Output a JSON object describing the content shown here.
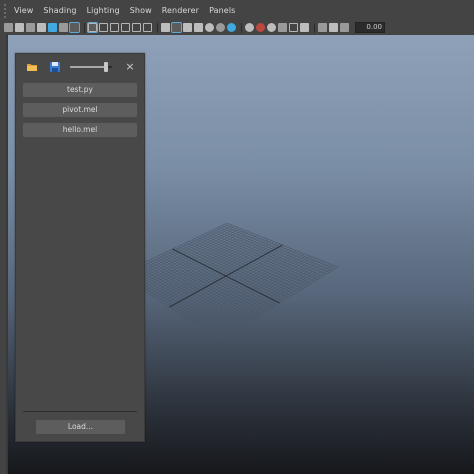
{
  "menubar": {
    "items": [
      "View",
      "Shading",
      "Lighting",
      "Show",
      "Renderer",
      "Panels"
    ]
  },
  "toolbar": {
    "zoom_value": "0.00"
  },
  "panel": {
    "scripts": [
      "test.py",
      "pivot.mel",
      "hello.mel"
    ],
    "load_label": "Load...",
    "close_glyph": "×",
    "slider_value": 0.85
  },
  "colors": {
    "accent": "#3fa9e0",
    "panel_bg": "#484848",
    "button_bg": "#5d5d5d"
  }
}
